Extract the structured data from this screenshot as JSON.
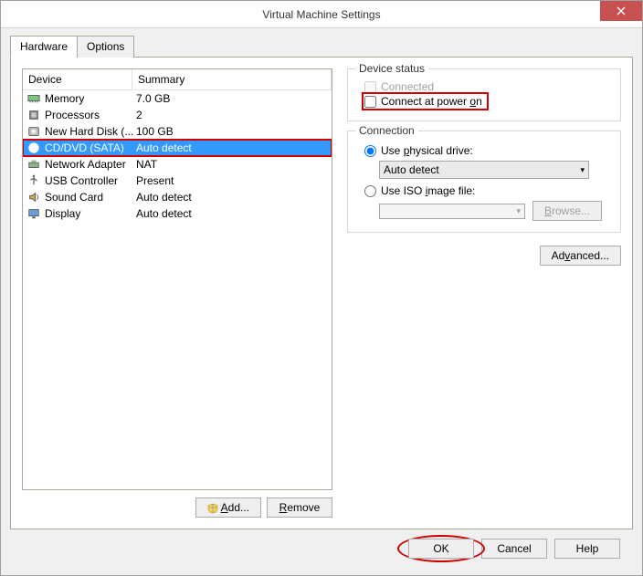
{
  "window": {
    "title": "Virtual Machine Settings"
  },
  "tabs": {
    "hardware": "Hardware",
    "options": "Options"
  },
  "headers": {
    "device": "Device",
    "summary": "Summary"
  },
  "devices": [
    {
      "name": "Memory",
      "summary": "7.0 GB",
      "icon": "memory"
    },
    {
      "name": "Processors",
      "summary": "2",
      "icon": "cpu"
    },
    {
      "name": "New Hard Disk (...",
      "summary": "100 GB",
      "icon": "hdd"
    },
    {
      "name": "CD/DVD (SATA)",
      "summary": "Auto detect",
      "icon": "cd",
      "selected": true,
      "highlighted": true
    },
    {
      "name": "Network Adapter",
      "summary": "NAT",
      "icon": "net"
    },
    {
      "name": "USB Controller",
      "summary": "Present",
      "icon": "usb"
    },
    {
      "name": "Sound Card",
      "summary": "Auto detect",
      "icon": "sound"
    },
    {
      "name": "Display",
      "summary": "Auto detect",
      "icon": "display"
    }
  ],
  "buttons": {
    "add": "Add...",
    "remove": "Remove",
    "browse": "Browse...",
    "advanced": "Advanced...",
    "ok": "OK",
    "cancel": "Cancel",
    "help": "Help"
  },
  "device_status": {
    "title": "Device status",
    "connected": "Connected",
    "connect_power_on": "Connect at power on"
  },
  "connection": {
    "title": "Connection",
    "use_physical": "Use physical drive:",
    "physical_value": "Auto detect",
    "use_iso": "Use ISO image file:",
    "iso_value": ""
  }
}
